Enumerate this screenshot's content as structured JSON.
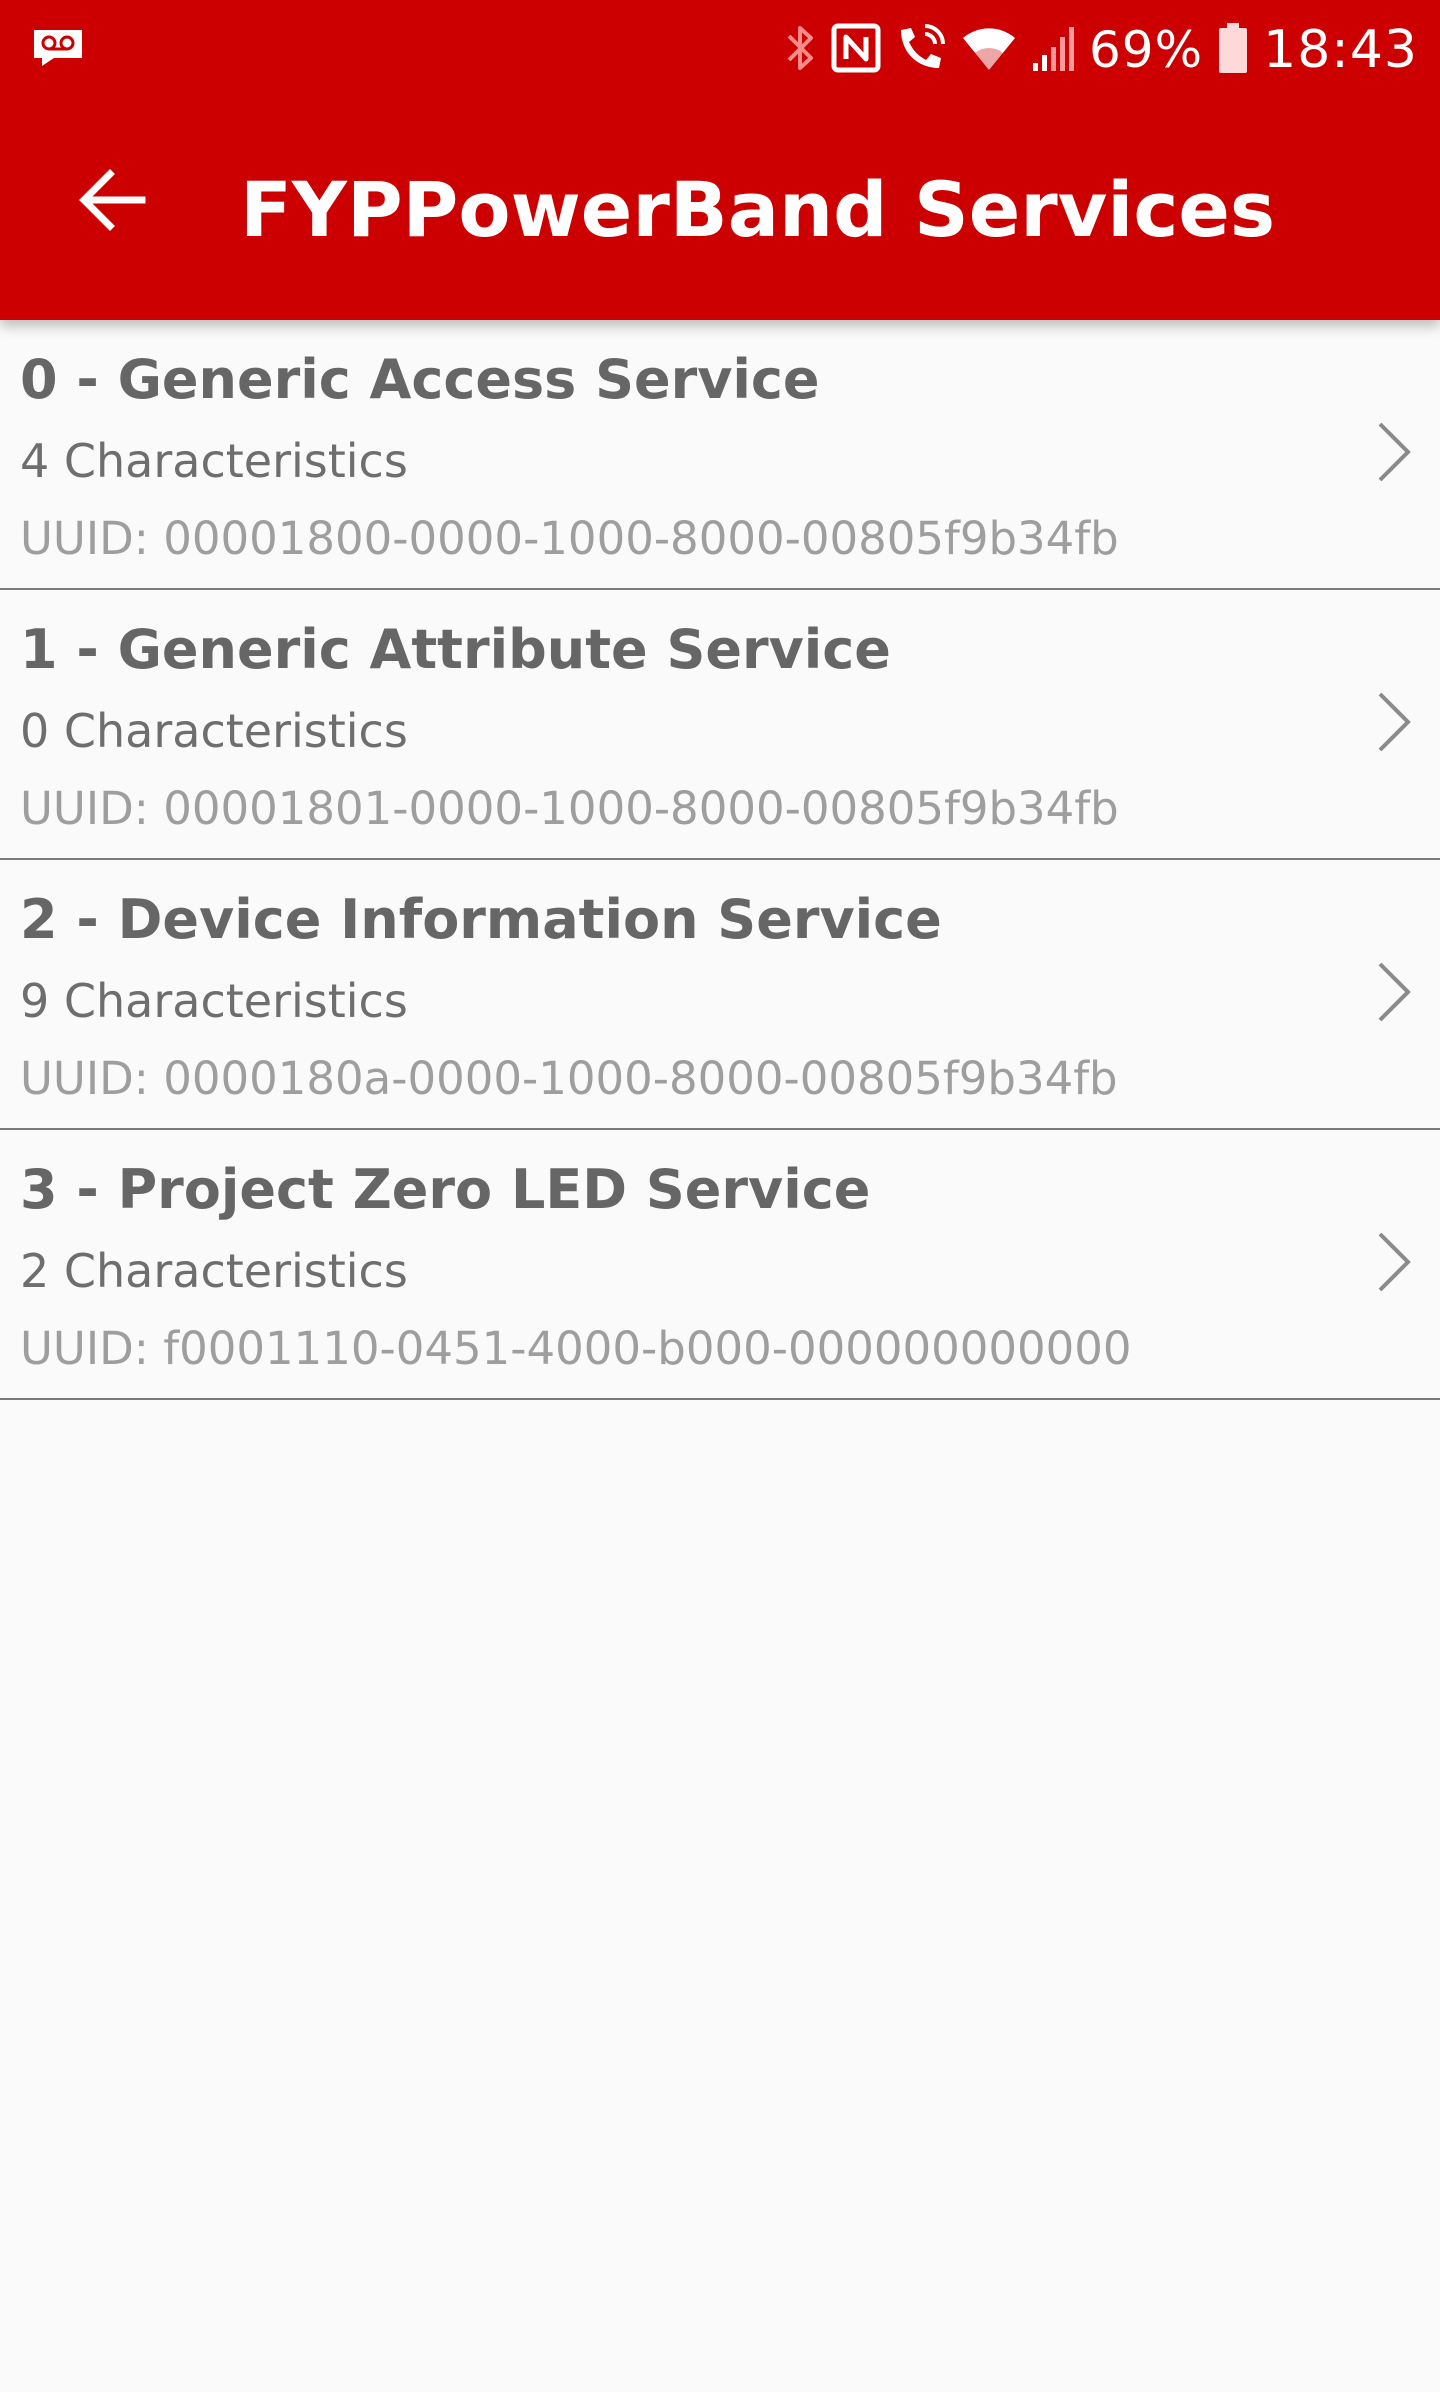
{
  "status_bar": {
    "battery_percent": "69%",
    "time": "18:43",
    "icons": [
      "voicemail-icon",
      "bluetooth-icon",
      "nfc-icon",
      "wifi-calling-icon",
      "wifi-icon",
      "signal-icon",
      "battery-icon"
    ]
  },
  "toolbar": {
    "title": "FYPPowerBand Services",
    "back_icon": "arrow-left-icon"
  },
  "services": [
    {
      "name": "0 - Generic Access Service",
      "characteristics": "4 Characteristics",
      "uuid": "UUID: 00001800-0000-1000-8000-00805f9b34fb"
    },
    {
      "name": "1 - Generic Attribute Service",
      "characteristics": "0 Characteristics",
      "uuid": "UUID: 00001801-0000-1000-8000-00805f9b34fb"
    },
    {
      "name": "2 - Device Information Service",
      "characteristics": "9 Characteristics",
      "uuid": "UUID: 0000180a-0000-1000-8000-00805f9b34fb"
    },
    {
      "name": "3 - Project Zero LED Service",
      "characteristics": "2 Characteristics",
      "uuid": "UUID: f0001110-0451-4000-b000-000000000000"
    }
  ],
  "colors": {
    "app_bar": "#cc0000",
    "background": "#fafafa",
    "title_text": "#666666",
    "uuid_text": "#9e9e9e",
    "divider": "#7a7a7a"
  }
}
